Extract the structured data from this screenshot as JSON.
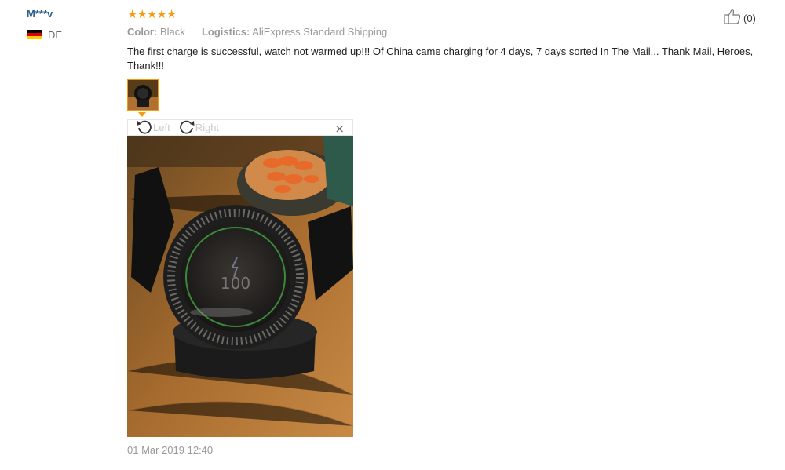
{
  "reviewer": {
    "name": "M***v",
    "country_code": "DE",
    "flag_colors": [
      "#000000",
      "#dd0000",
      "#ffce00"
    ]
  },
  "rating": {
    "stars": 5,
    "max": 5,
    "star_color": "#f39c12"
  },
  "helpful": {
    "count_text": "(0)",
    "icon": "thumbs-up-icon"
  },
  "meta": {
    "color_label": "Color:",
    "color_value": "Black",
    "logistics_label": "Logistics:",
    "logistics_value": "AliExpress Standard Shipping"
  },
  "review_text": "The first charge is successful, watch not warmed up!!! Of China came charging for 4 days, 7 days sorted In The Mail... Thank Mail, Heroes, Thank!!!",
  "image_viewer": {
    "rotate_left_label": "Left",
    "rotate_right_label": "Right",
    "close_symbol": "×",
    "watch_display": "100"
  },
  "date": "01 Mar 2019 12:40",
  "colors": {
    "accent": "#f39c12",
    "name_blue": "#2f5f8f",
    "muted": "#999999"
  }
}
